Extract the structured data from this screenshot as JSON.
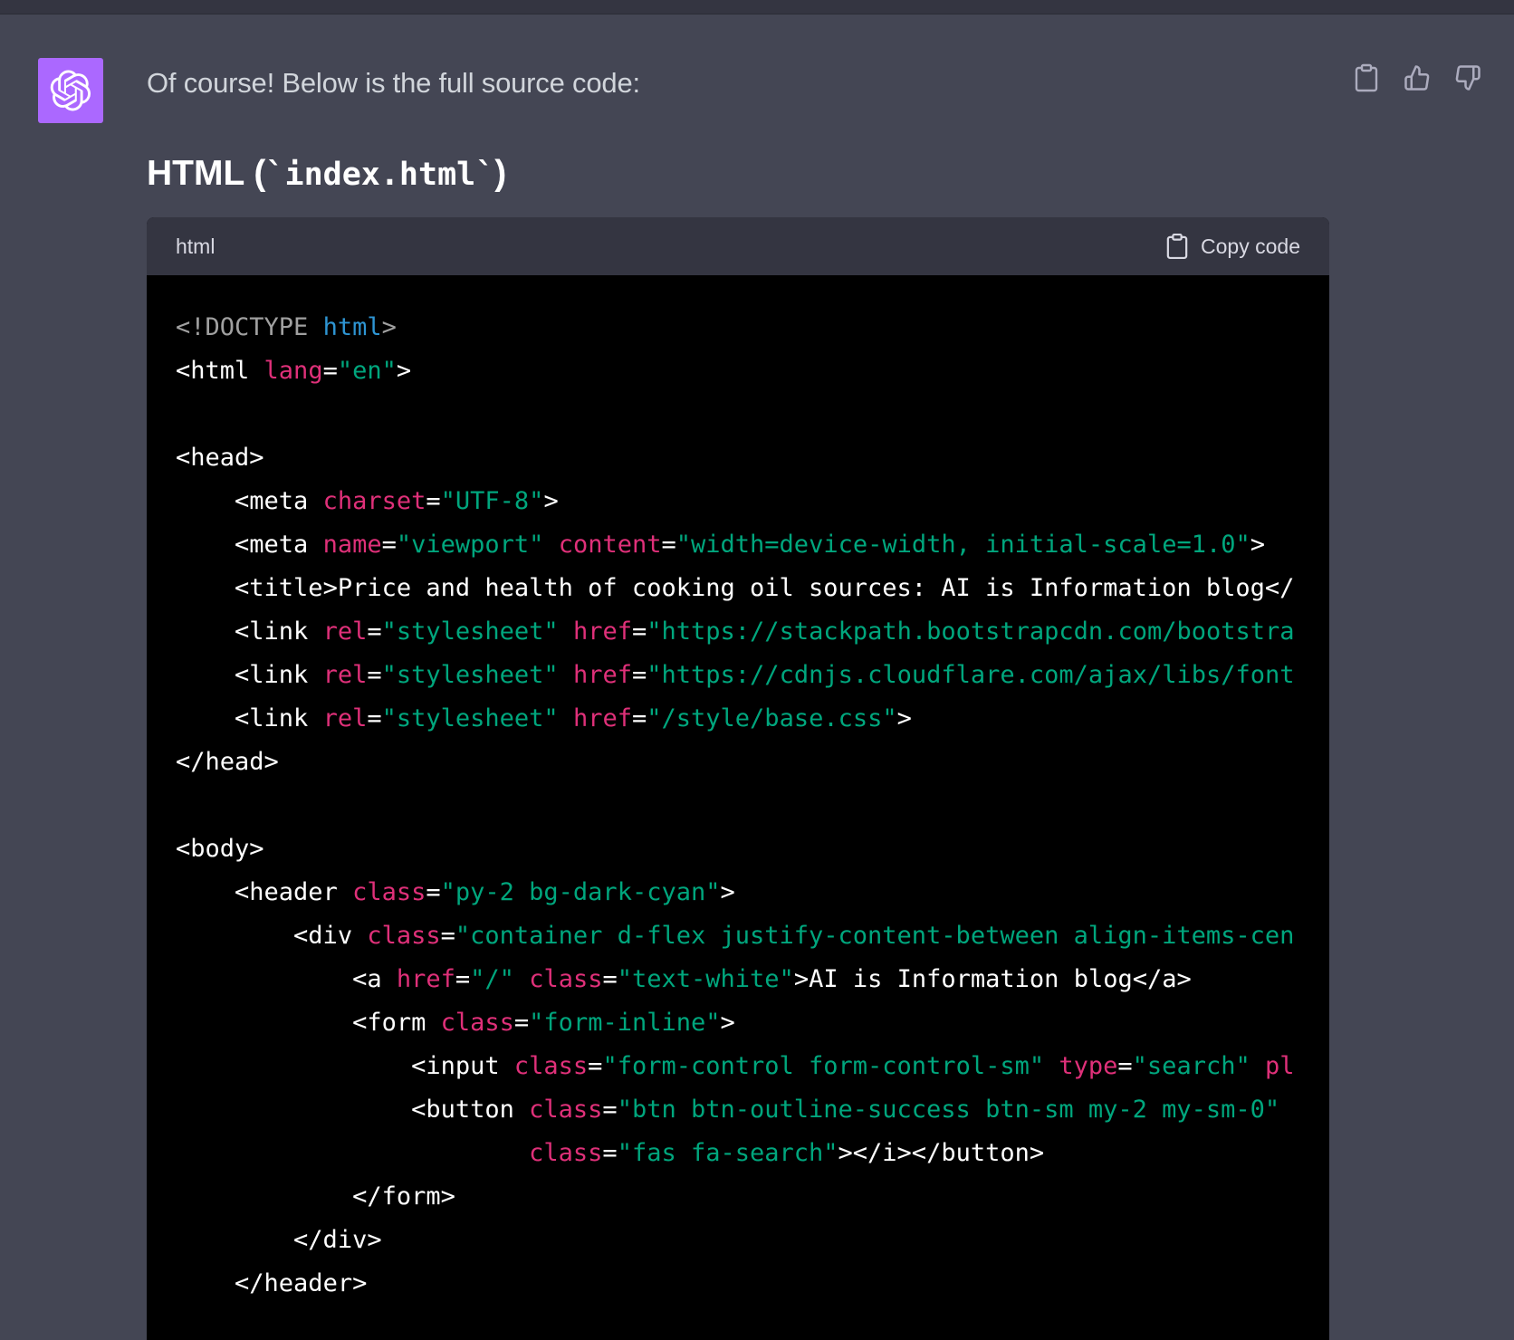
{
  "message": {
    "intro_text": "Of course! Below is the full source code:",
    "heading_prefix": "HTML (",
    "heading_code": "`index.html`",
    "heading_suffix": ")"
  },
  "actions": [
    {
      "name": "copy-message-button",
      "icon": "clipboard-icon"
    },
    {
      "name": "thumbs-up-button",
      "icon": "thumbs-up-icon"
    },
    {
      "name": "thumbs-down-button",
      "icon": "thumbs-down-icon"
    }
  ],
  "codeblock": {
    "language": "html",
    "copy_label": "Copy code",
    "lines": [
      [
        [
          "meta",
          "<!DOCTYPE "
        ],
        [
          "kw",
          "html"
        ],
        [
          "meta",
          ">"
        ]
      ],
      [
        [
          "tag",
          "<html "
        ],
        [
          "attr",
          "lang"
        ],
        [
          "tag",
          "="
        ],
        [
          "str",
          "\"en\""
        ],
        [
          "tag",
          ">"
        ]
      ],
      [],
      [
        [
          "tag",
          "<head>"
        ]
      ],
      [
        [
          "text",
          "    "
        ],
        [
          "tag",
          "<meta "
        ],
        [
          "attr",
          "charset"
        ],
        [
          "tag",
          "="
        ],
        [
          "str",
          "\"UTF-8\""
        ],
        [
          "tag",
          ">"
        ]
      ],
      [
        [
          "text",
          "    "
        ],
        [
          "tag",
          "<meta "
        ],
        [
          "attr",
          "name"
        ],
        [
          "tag",
          "="
        ],
        [
          "str",
          "\"viewport\""
        ],
        [
          "text",
          " "
        ],
        [
          "attr",
          "content"
        ],
        [
          "tag",
          "="
        ],
        [
          "str",
          "\"width=device-width, initial-scale=1.0\""
        ],
        [
          "tag",
          ">"
        ]
      ],
      [
        [
          "text",
          "    "
        ],
        [
          "tag",
          "<title>"
        ],
        [
          "text",
          "Price and health of cooking oil sources: AI is Information blog"
        ],
        [
          "tag",
          "</"
        ]
      ],
      [
        [
          "text",
          "    "
        ],
        [
          "tag",
          "<link "
        ],
        [
          "attr",
          "rel"
        ],
        [
          "tag",
          "="
        ],
        [
          "str",
          "\"stylesheet\""
        ],
        [
          "text",
          " "
        ],
        [
          "attr",
          "href"
        ],
        [
          "tag",
          "="
        ],
        [
          "str",
          "\"https://stackpath.bootstrapcdn.com/bootstra"
        ]
      ],
      [
        [
          "text",
          "    "
        ],
        [
          "tag",
          "<link "
        ],
        [
          "attr",
          "rel"
        ],
        [
          "tag",
          "="
        ],
        [
          "str",
          "\"stylesheet\""
        ],
        [
          "text",
          " "
        ],
        [
          "attr",
          "href"
        ],
        [
          "tag",
          "="
        ],
        [
          "str",
          "\"https://cdnjs.cloudflare.com/ajax/libs/font"
        ]
      ],
      [
        [
          "text",
          "    "
        ],
        [
          "tag",
          "<link "
        ],
        [
          "attr",
          "rel"
        ],
        [
          "tag",
          "="
        ],
        [
          "str",
          "\"stylesheet\""
        ],
        [
          "text",
          " "
        ],
        [
          "attr",
          "href"
        ],
        [
          "tag",
          "="
        ],
        [
          "str",
          "\"/style/base.css\""
        ],
        [
          "tag",
          ">"
        ]
      ],
      [
        [
          "tag",
          "</head>"
        ]
      ],
      [],
      [
        [
          "tag",
          "<body>"
        ]
      ],
      [
        [
          "text",
          "    "
        ],
        [
          "tag",
          "<header "
        ],
        [
          "attr",
          "class"
        ],
        [
          "tag",
          "="
        ],
        [
          "str",
          "\"py-2 bg-dark-cyan\""
        ],
        [
          "tag",
          ">"
        ]
      ],
      [
        [
          "text",
          "        "
        ],
        [
          "tag",
          "<div "
        ],
        [
          "attr",
          "class"
        ],
        [
          "tag",
          "="
        ],
        [
          "str",
          "\"container d-flex justify-content-between align-items-cen"
        ]
      ],
      [
        [
          "text",
          "            "
        ],
        [
          "tag",
          "<a "
        ],
        [
          "attr",
          "href"
        ],
        [
          "tag",
          "="
        ],
        [
          "str",
          "\"/\""
        ],
        [
          "text",
          " "
        ],
        [
          "attr",
          "class"
        ],
        [
          "tag",
          "="
        ],
        [
          "str",
          "\"text-white\""
        ],
        [
          "tag",
          ">"
        ],
        [
          "text",
          "AI is Information blog"
        ],
        [
          "tag",
          "</a>"
        ]
      ],
      [
        [
          "text",
          "            "
        ],
        [
          "tag",
          "<form "
        ],
        [
          "attr",
          "class"
        ],
        [
          "tag",
          "="
        ],
        [
          "str",
          "\"form-inline\""
        ],
        [
          "tag",
          ">"
        ]
      ],
      [
        [
          "text",
          "                "
        ],
        [
          "tag",
          "<input "
        ],
        [
          "attr",
          "class"
        ],
        [
          "tag",
          "="
        ],
        [
          "str",
          "\"form-control form-control-sm\""
        ],
        [
          "text",
          " "
        ],
        [
          "attr",
          "type"
        ],
        [
          "tag",
          "="
        ],
        [
          "str",
          "\"search\""
        ],
        [
          "text",
          " "
        ],
        [
          "attr",
          "pl"
        ]
      ],
      [
        [
          "text",
          "                "
        ],
        [
          "tag",
          "<button "
        ],
        [
          "attr",
          "class"
        ],
        [
          "tag",
          "="
        ],
        [
          "str",
          "\"btn btn-outline-success btn-sm my-2 my-sm-0\""
        ]
      ],
      [
        [
          "text",
          "                        "
        ],
        [
          "attr",
          "class"
        ],
        [
          "tag",
          "="
        ],
        [
          "str",
          "\"fas fa-search\""
        ],
        [
          "tag",
          "></i></button>"
        ]
      ],
      [
        [
          "text",
          "            "
        ],
        [
          "tag",
          "</form>"
        ]
      ],
      [
        [
          "text",
          "        "
        ],
        [
          "tag",
          "</div>"
        ]
      ],
      [
        [
          "text",
          "    "
        ],
        [
          "tag",
          "</header>"
        ]
      ]
    ]
  }
}
